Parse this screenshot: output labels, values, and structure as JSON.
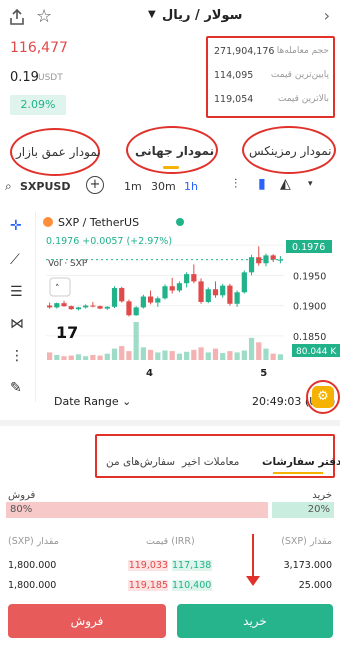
{
  "header": {
    "pair": "سولار / ریال",
    "price_irr": "116,477",
    "price_usdt": "0.19",
    "usdt_unit": "USDT",
    "change": "2.09%"
  },
  "stats": [
    {
      "label": "حجم معامله‌ها",
      "value": "271,904,176"
    },
    {
      "label": "پایین‌ترین قیمت",
      "value": "114,095"
    },
    {
      "label": "بالاترین قیمت",
      "value": "119,054"
    }
  ],
  "chart_tabs": [
    {
      "label": "نمودار عمق بازار"
    },
    {
      "label": "نمودار جهانی"
    },
    {
      "label": "نمودار رمزینکس"
    }
  ],
  "toolbar": {
    "symbol": "SXPUSD",
    "intervals": [
      "1m",
      "30m",
      "1h"
    ]
  },
  "chart_data": {
    "type": "candlestick",
    "title": "SXP / TetherUS",
    "ohlc_line": "0.1976 +0.0057 (+2.97%)",
    "volume_label": "Vol · SXP",
    "x_ticks": [
      "4",
      "5"
    ],
    "y_ticks": [
      "0.2000",
      "0.1950",
      "0.1900",
      "0.1850"
    ],
    "ylim": [
      0.181,
      0.2025
    ],
    "last_price_label": "0.1976",
    "volume_value_label": "80.044 K",
    "candles": [
      [
        0.19,
        0.1905,
        0.1895,
        0.1897
      ],
      [
        0.1897,
        0.1905,
        0.1895,
        0.1904
      ],
      [
        0.1904,
        0.1908,
        0.1898,
        0.1899
      ],
      [
        0.1899,
        0.19,
        0.1893,
        0.1894
      ],
      [
        0.1894,
        0.1898,
        0.1892,
        0.1897
      ],
      [
        0.1897,
        0.1902,
        0.1895,
        0.19
      ],
      [
        0.19,
        0.1906,
        0.1897,
        0.1899
      ],
      [
        0.1899,
        0.19,
        0.1894,
        0.1895
      ],
      [
        0.1895,
        0.1899,
        0.1893,
        0.1898
      ],
      [
        0.1898,
        0.1932,
        0.1896,
        0.1929
      ],
      [
        0.1929,
        0.1931,
        0.1905,
        0.1907
      ],
      [
        0.1907,
        0.191,
        0.1882,
        0.1884
      ],
      [
        0.1884,
        0.1899,
        0.1883,
        0.1897
      ],
      [
        0.1897,
        0.1918,
        0.1895,
        0.1915
      ],
      [
        0.1915,
        0.1925,
        0.1902,
        0.1905
      ],
      [
        0.1905,
        0.1915,
        0.1898,
        0.1912
      ],
      [
        0.1912,
        0.1935,
        0.191,
        0.1932
      ],
      [
        0.1932,
        0.1946,
        0.192,
        0.1925
      ],
      [
        0.1925,
        0.194,
        0.1922,
        0.1937
      ],
      [
        0.1937,
        0.1955,
        0.193,
        0.1952
      ],
      [
        0.1952,
        0.1968,
        0.1937,
        0.194
      ],
      [
        0.194,
        0.1945,
        0.1903,
        0.1906
      ],
      [
        0.1906,
        0.193,
        0.1904,
        0.1927
      ],
      [
        0.1927,
        0.194,
        0.1913,
        0.1917
      ],
      [
        0.1917,
        0.1936,
        0.1913,
        0.1933
      ],
      [
        0.1933,
        0.1936,
        0.19,
        0.1903
      ],
      [
        0.1903,
        0.1925,
        0.1898,
        0.1922
      ],
      [
        0.1922,
        0.1958,
        0.192,
        0.1955
      ],
      [
        0.1955,
        0.1984,
        0.195,
        0.198
      ],
      [
        0.198,
        0.1998,
        0.1966,
        0.197
      ],
      [
        0.197,
        0.1986,
        0.1965,
        0.1983
      ],
      [
        0.1983,
        0.1985,
        0.1972,
        0.1976
      ],
      [
        0.1976,
        0.1982,
        0.197,
        0.1976
      ]
    ],
    "volumes": [
      12,
      8,
      6,
      7,
      9,
      6,
      8,
      7,
      10,
      18,
      22,
      14,
      60,
      20,
      16,
      12,
      15,
      14,
      10,
      13,
      16,
      20,
      12,
      18,
      11,
      14,
      12,
      15,
      35,
      28,
      18,
      10,
      9
    ],
    "volume_max": 60
  },
  "chart_tools": [
    "crosshair",
    "trend-line",
    "fib",
    "pattern",
    "measure",
    "brush"
  ],
  "footer": {
    "date_range": "Date Range",
    "clock": "20:49:03 (UTC)"
  },
  "orderbook": {
    "tabs": [
      "دفتر سفارشات",
      "معاملات اخیر",
      "سفارش‌های من"
    ],
    "buy_label": "خرید",
    "sell_label": "فروش",
    "sell_pct": "80%",
    "buy_pct": "20%",
    "col_amount_right": "(SXP) مقدار",
    "col_price": "قیمت (IRR)",
    "col_amount_left": "(SXP) مقدار",
    "rows": [
      {
        "sell_amt": "1,800.000",
        "sell_price": "119,033",
        "buy_price": "117,138",
        "buy_amt": "3,173.000"
      },
      {
        "sell_amt": "1,800.000",
        "sell_price": "119,185",
        "buy_price": "110,400",
        "buy_amt": "25.000"
      }
    ]
  },
  "buttons": {
    "sell": "فروش",
    "buy": "خرید"
  },
  "colors": {
    "up": "#21b28a",
    "down": "#e04a4a",
    "annotation": "#e0312b",
    "accent": "#f6b200"
  }
}
